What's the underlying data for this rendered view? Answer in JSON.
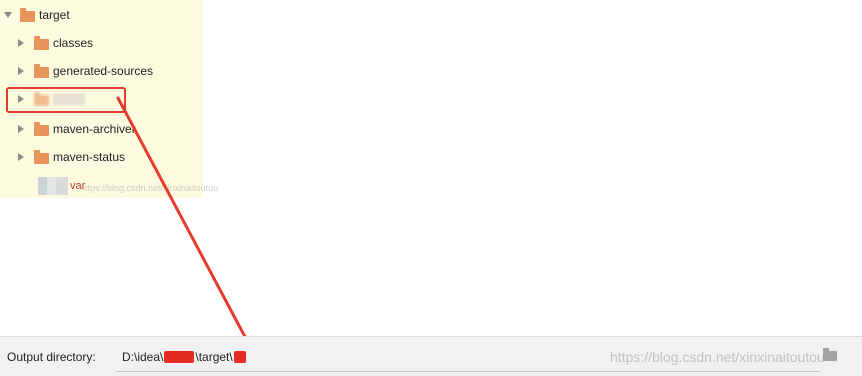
{
  "tree": {
    "root": {
      "label": "target",
      "expanded": true
    },
    "children": [
      {
        "label": "classes"
      },
      {
        "label": "generated-sources"
      },
      {
        "label": ""
      },
      {
        "label": "maven-archiver"
      },
      {
        "label": "maven-status"
      }
    ],
    "file": {
      "label": "var"
    }
  },
  "watermark": {
    "small": "https://blog.csdn.net/xinxinaitoutou",
    "large": "https://blog.csdn.net/xinxinaitoutou"
  },
  "output": {
    "label": "Output directory:",
    "path_prefix": "D:\\idea\\",
    "path_middle": "\\target\\"
  },
  "colors": {
    "tree_background": "#fdfbdf",
    "folder": "#e8935a",
    "annotation": "#e53b2c",
    "redaction": "#e32d22"
  },
  "icons": {
    "folder": "folder-icon",
    "expand": "chevron-right-icon",
    "collapse": "chevron-down-icon",
    "browse": "folder-browse-icon"
  }
}
